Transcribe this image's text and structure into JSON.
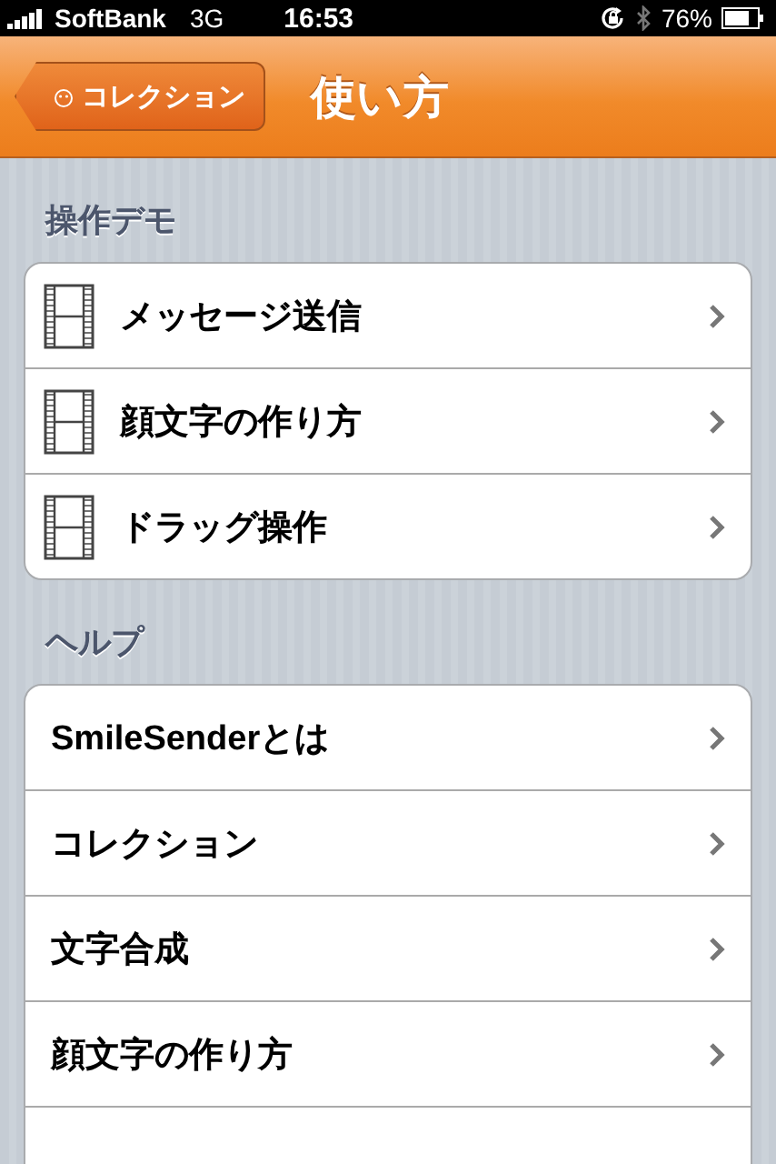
{
  "status_bar": {
    "carrier": "SoftBank",
    "network": "3G",
    "time": "16:53",
    "battery": "76%"
  },
  "nav_bar": {
    "back_button": "コレクション",
    "title": "使い方"
  },
  "sections": [
    {
      "header": "操作デモ",
      "items": [
        {
          "kind": "video",
          "label": "メッセージ送信"
        },
        {
          "kind": "video",
          "label": "顔文字の作り方"
        },
        {
          "kind": "video",
          "label": "ドラッグ操作"
        }
      ]
    },
    {
      "header": "ヘルプ",
      "items": [
        {
          "kind": "plain",
          "label": "SmileSenderとは"
        },
        {
          "kind": "plain",
          "label": "コレクション"
        },
        {
          "kind": "plain",
          "label": "文字合成"
        },
        {
          "kind": "plain",
          "label": "顔文字の作り方"
        }
      ]
    }
  ]
}
